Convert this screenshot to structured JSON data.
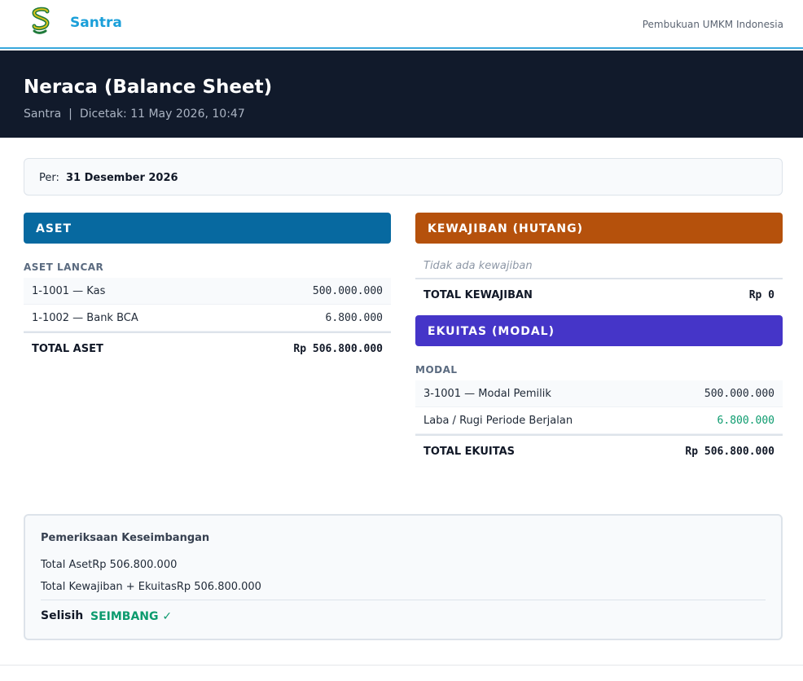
{
  "header": {
    "brand": "Santra",
    "tagline": "Pembukuan UMKM Indonesia"
  },
  "report": {
    "title": "Neraca (Balance Sheet)",
    "company": "Santra",
    "printed": "Dicetak: 11 May 2026, 10:47"
  },
  "period": {
    "label": "Per:",
    "value": "31 Desember 2026"
  },
  "aset": {
    "heading": "ASET",
    "group": "ASET LANCAR",
    "rows": [
      {
        "name": "1-1001 — Kas",
        "amount": "500.000.000"
      },
      {
        "name": "1-1002 — Bank BCA",
        "amount": "6.800.000"
      }
    ],
    "total_label": "TOTAL ASET",
    "total_amount": "Rp 506.800.000"
  },
  "kewajiban": {
    "heading": "KEWAJIBAN (HUTANG)",
    "empty": "Tidak ada kewajiban",
    "total_label": "TOTAL KEWAJIBAN",
    "total_amount": "Rp 0"
  },
  "ekuitas": {
    "heading": "EKUITAS (MODAL)",
    "group": "MODAL",
    "rows": [
      {
        "name": "3-1001 — Modal Pemilik",
        "amount": "500.000.000"
      },
      {
        "name": "Laba / Rugi Periode Berjalan",
        "amount": "6.800.000"
      }
    ],
    "total_label": "TOTAL EKUITAS",
    "total_amount": "Rp 506.800.000"
  },
  "check": {
    "title": "Pemeriksaan Keseimbangan",
    "line1": "Total AsetRp 506.800.000",
    "line2": "Total Kewajiban + EkuitasRp 506.800.000",
    "selisih_label": "Selisih",
    "status": "SEIMBANG ✓"
  },
  "colors": {
    "brand": "#1a9fd9",
    "aset": "#0769a0",
    "kewajiban": "#b5510c",
    "ekuitas": "#4535c8",
    "positive": "#0c9b6e"
  }
}
